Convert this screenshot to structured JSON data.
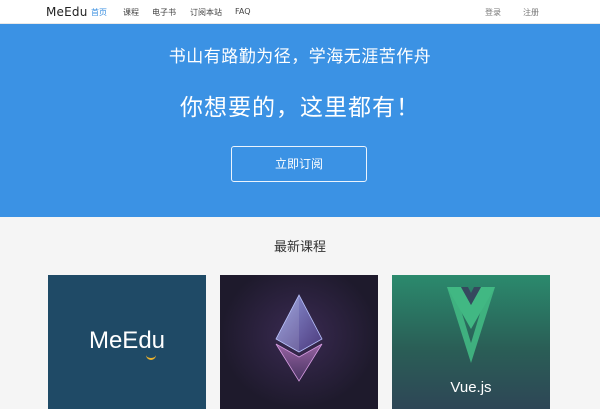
{
  "nav": {
    "brand": "MeEdu",
    "items": [
      "首页",
      "课程",
      "电子书",
      "订阅本站",
      "FAQ"
    ],
    "login": "登录",
    "register": "注册"
  },
  "hero": {
    "subtitle": "书山有路勤为径，学海无涯苦作舟",
    "title": "你想要的，这里都有！",
    "button": "立即订阅"
  },
  "section": {
    "title": "最新课程"
  },
  "courses": [
    {
      "logo_text": "MeEdu",
      "icon": "meedu-logo-icon"
    },
    {
      "icon": "ethereum-icon"
    },
    {
      "logo_text": "Vue.js",
      "icon": "vuejs-logo-icon"
    }
  ],
  "colors": {
    "hero": "#3b92e4",
    "nav_active": "#3a8fe0",
    "card1": "#1f4a66",
    "vue_green": "#41b883",
    "vue_dark": "#35495e"
  }
}
